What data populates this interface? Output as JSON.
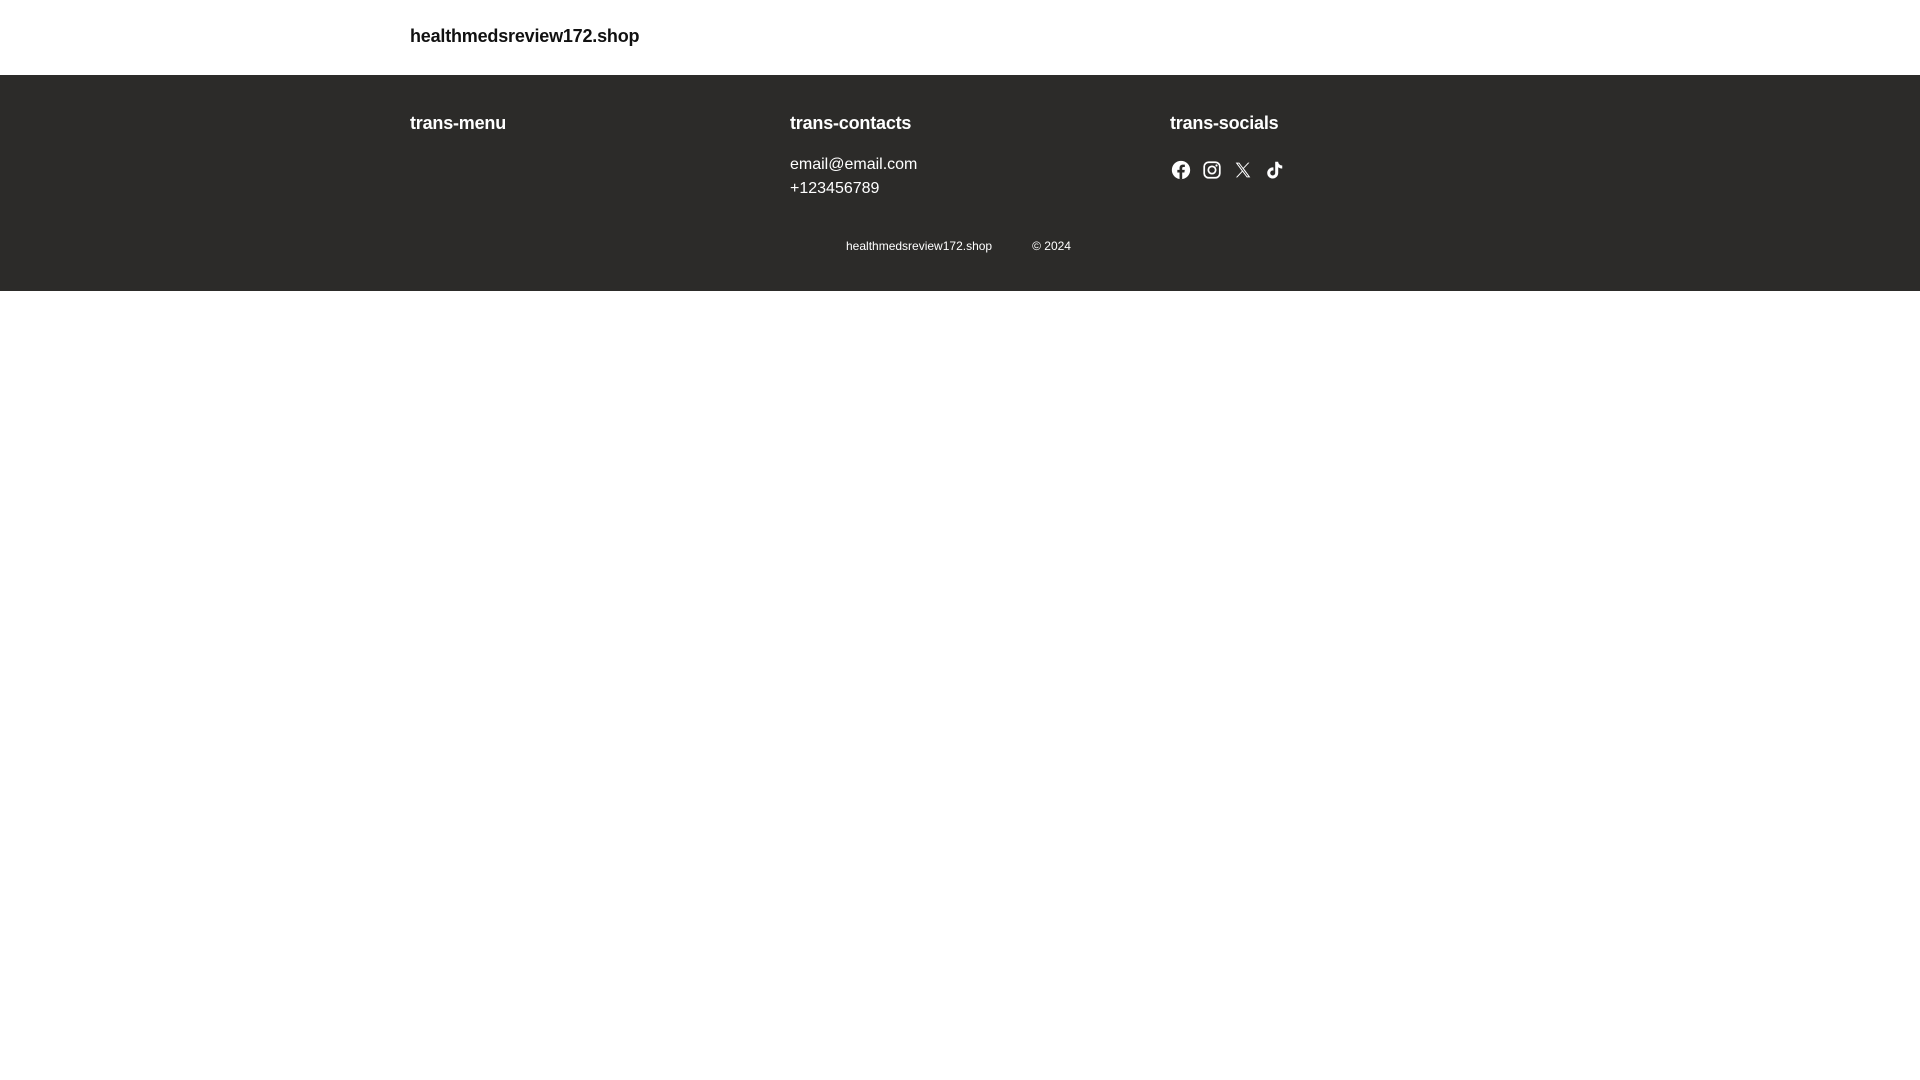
{
  "header": {
    "site_name": "healthmedsreview172.shop"
  },
  "footer": {
    "menu": {
      "title": "trans-menu"
    },
    "contacts": {
      "title": "trans-contacts",
      "email": "email@email.com",
      "phone": "+123456789"
    },
    "socials": {
      "title": "trans-socials",
      "icons": [
        "facebook-icon",
        "instagram-icon",
        "x-icon",
        "tiktok-icon"
      ]
    },
    "bottom": {
      "site_name": "healthmedsreview172.shop",
      "copyright": "© 2024"
    }
  },
  "colors": {
    "footer_bg": "#2c2b29",
    "header_bg": "#ffffff",
    "text_dark": "#111111",
    "text_light": "#ffffff"
  }
}
